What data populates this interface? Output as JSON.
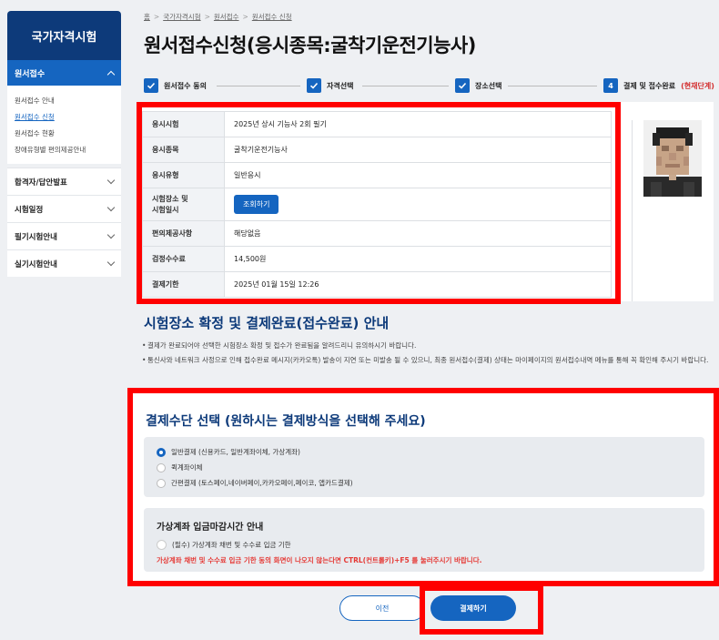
{
  "sidebar": {
    "title": "국가자격시험",
    "active_section": "원서접수",
    "sub_items": [
      "원서접수 안내",
      "원서접수 신청",
      "원서접수 현황",
      "장애유형별 편의제공안내"
    ],
    "menu": [
      "합격자/답안발표",
      "시험일정",
      "필기시험안내",
      "실기시험안내"
    ]
  },
  "breadcrumb": [
    "홈",
    "국가자격시험",
    "원서접수",
    "원서접수 신청"
  ],
  "page_title": "원서접수신청(응시종목:굴착기운전기능사)",
  "steps": {
    "s1": "원서접수 동의",
    "s2": "자격선택",
    "s3": "장소선택",
    "s4_num": "4",
    "s4": "결제 및 접수완료",
    "s4_current": "(현재단계)"
  },
  "info": {
    "rows": [
      {
        "label": "응시시험",
        "value": "2025년 상시 기능사 2회 필기"
      },
      {
        "label": "응시종목",
        "value": "굴착기운전기능사"
      },
      {
        "label": "응시유형",
        "value": "일반응시"
      },
      {
        "label": "시험장소 및\n시험일시",
        "value": "조회하기"
      },
      {
        "label": "편의제공사항",
        "value": "해당없음"
      },
      {
        "label": "검정수수료",
        "value": "14,500원"
      },
      {
        "label": "결제기한",
        "value": "2025년 01월 15일 12:26"
      }
    ]
  },
  "notice": {
    "title": "시험장소 확정 및 결제완료(접수완료) 안내",
    "items": [
      "결제가 완료되어야 선택한 시험장소 확정 및 접수가 완료됨을 알려드리니 유의하시기 바랍니다.",
      "통신사와 네트워크 사정으로 인해 접수완료 메시지(카카오톡) 발송이 지연 또는 미발송 될 수 있으니, 최종 원서접수(결제) 상태는 마이페이지의 원서접수내역 메뉴를 통해 꼭 확인해 주시기 바랍니다."
    ]
  },
  "payment": {
    "title": "결제수단 선택 (원하시는 결제방식을 선택해 주세요)",
    "options": [
      "일반결제 (신용카드, 일반계좌이체, 가상계좌)",
      "퀵계좌이체",
      "간편결제 (토스페이,네이버페이,카카오페이,페이코, 앱카드결제)"
    ],
    "selected_index": 0,
    "deadline_title": "가상계좌 입금마감시간 안내",
    "deadline_check": "(필수) 가상계좌 채번 및 수수료 입금 기한",
    "deadline_warn": "가상계좌 채번 및 수수료 입금 기한 동의 화면이 나오지 않는다면 CTRL(컨트롤키)+F5 를 눌러주시기 바랍니다."
  },
  "buttons": {
    "prev": "이전",
    "pay": "결제하기"
  },
  "colors": {
    "primary": "#1565c0",
    "navy": "#0d3a7a",
    "highlight": "#ff0000",
    "warn": "#e53935"
  }
}
